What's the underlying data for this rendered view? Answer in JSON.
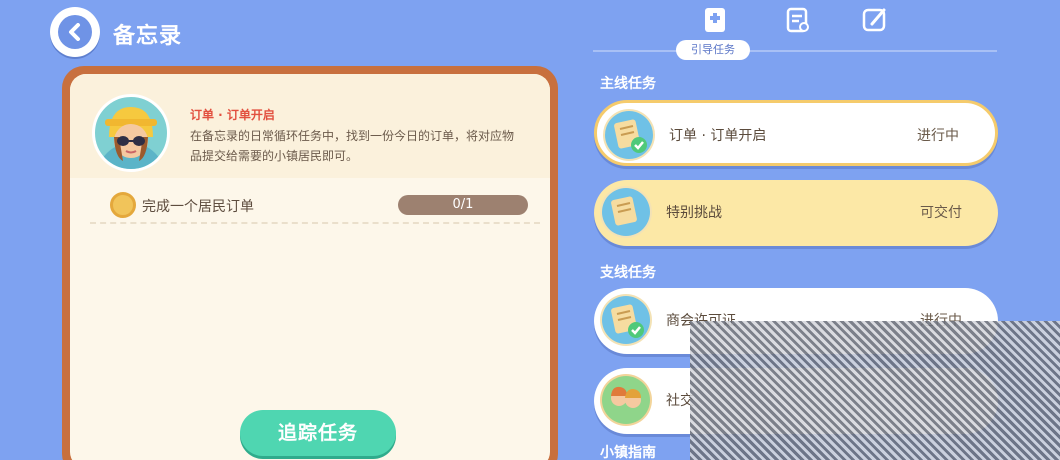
{
  "header": {
    "title": "备忘录"
  },
  "quest_detail": {
    "name": "订单 · 订单开启",
    "description": "在备忘录的日常循环任务中，找到一份今日的订单，将对应物品提交给需要的小镇居民即可。",
    "objective": "完成一个居民订单",
    "progress_text": "0/1",
    "progress_fraction": 0,
    "track_button": "追踪任务"
  },
  "right_panel": {
    "guide_tab": "引导任务",
    "sections": {
      "main": "主线任务",
      "side": "支线任务",
      "town": "小镇指南"
    },
    "main_quests": [
      {
        "name": "订单 · 订单开启",
        "status": "进行中"
      },
      {
        "name": "特别挑战",
        "status": "可交付"
      }
    ],
    "side_quests": [
      {
        "name": "商会许可证",
        "status": "进行中"
      },
      {
        "name": "社交",
        "status": ""
      }
    ]
  },
  "colors": {
    "background": "#7ea2f1",
    "card_border": "#c8703e",
    "accent_red": "#e2503f",
    "button_green": "#4fd6b1",
    "deliverable_yellow": "#fce8a6"
  }
}
